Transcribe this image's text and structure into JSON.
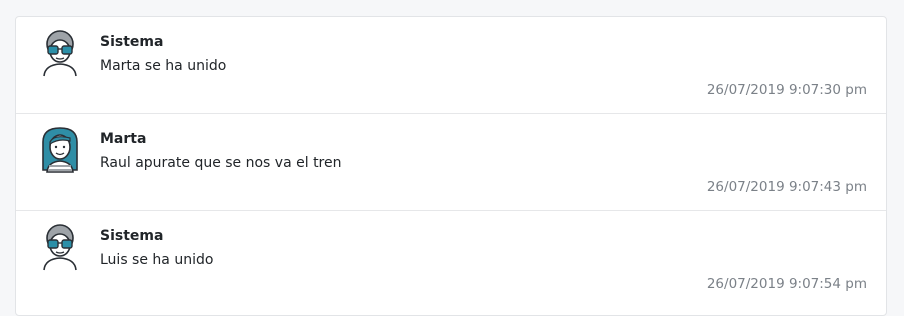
{
  "messages": [
    {
      "author": "Sistema",
      "text": "Marta se ha unido",
      "time": "26/07/2019 9:07:30 pm",
      "avatar": "system-avatar-icon"
    },
    {
      "author": "Marta",
      "text": "Raul apurate que se nos va el tren",
      "time": "26/07/2019 9:07:43 pm",
      "avatar": "marta-avatar-icon"
    },
    {
      "author": "Sistema",
      "text": "Luis se ha unido",
      "time": "26/07/2019 9:07:54 pm",
      "avatar": "system-avatar-icon"
    }
  ],
  "colors": {
    "lens": "#2b8fa8",
    "hair_gray": "#9ea3a8",
    "hair_teal": "#2f8ea6",
    "outline": "#2a2f35"
  }
}
